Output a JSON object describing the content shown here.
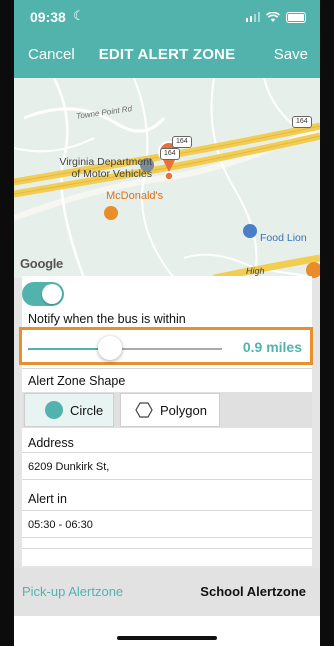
{
  "status_bar": {
    "time": "09:38",
    "moon": "☾"
  },
  "navbar": {
    "cancel": "Cancel",
    "title": "EDIT ALERT ZONE",
    "save": "Save"
  },
  "map": {
    "labels": {
      "road": "Towne Point Rd",
      "dmv_line1": "Virginia Department",
      "dmv_line2": "of Motor Vehicles",
      "mcdonalds": "McDonald's",
      "food_lion": "Food Lion",
      "high": "High",
      "google": "Google"
    },
    "shields": {
      "s1": "164",
      "s2": "164",
      "s3": "164"
    },
    "marker_color": "#e5723a"
  },
  "form": {
    "notify_label": "Notify when the bus is within",
    "toggle_on": true,
    "radius_value": "0.9 miles",
    "radius_fraction": 0.37,
    "shape_label": "Alert Zone Shape",
    "shape_options": [
      "Circle",
      "Polygon"
    ],
    "selected_shape": "Circle",
    "address_label": "Address",
    "address_value": "6209 Dunkirk St,",
    "alert_label": "Alert in",
    "alert_value": "05:30 - 06:30"
  },
  "tabs": {
    "pickup": "Pick-up Alertzone",
    "school": "School Alertzone"
  },
  "colors": {
    "accent": "#52b3ad",
    "highlight": "#e7902d"
  }
}
